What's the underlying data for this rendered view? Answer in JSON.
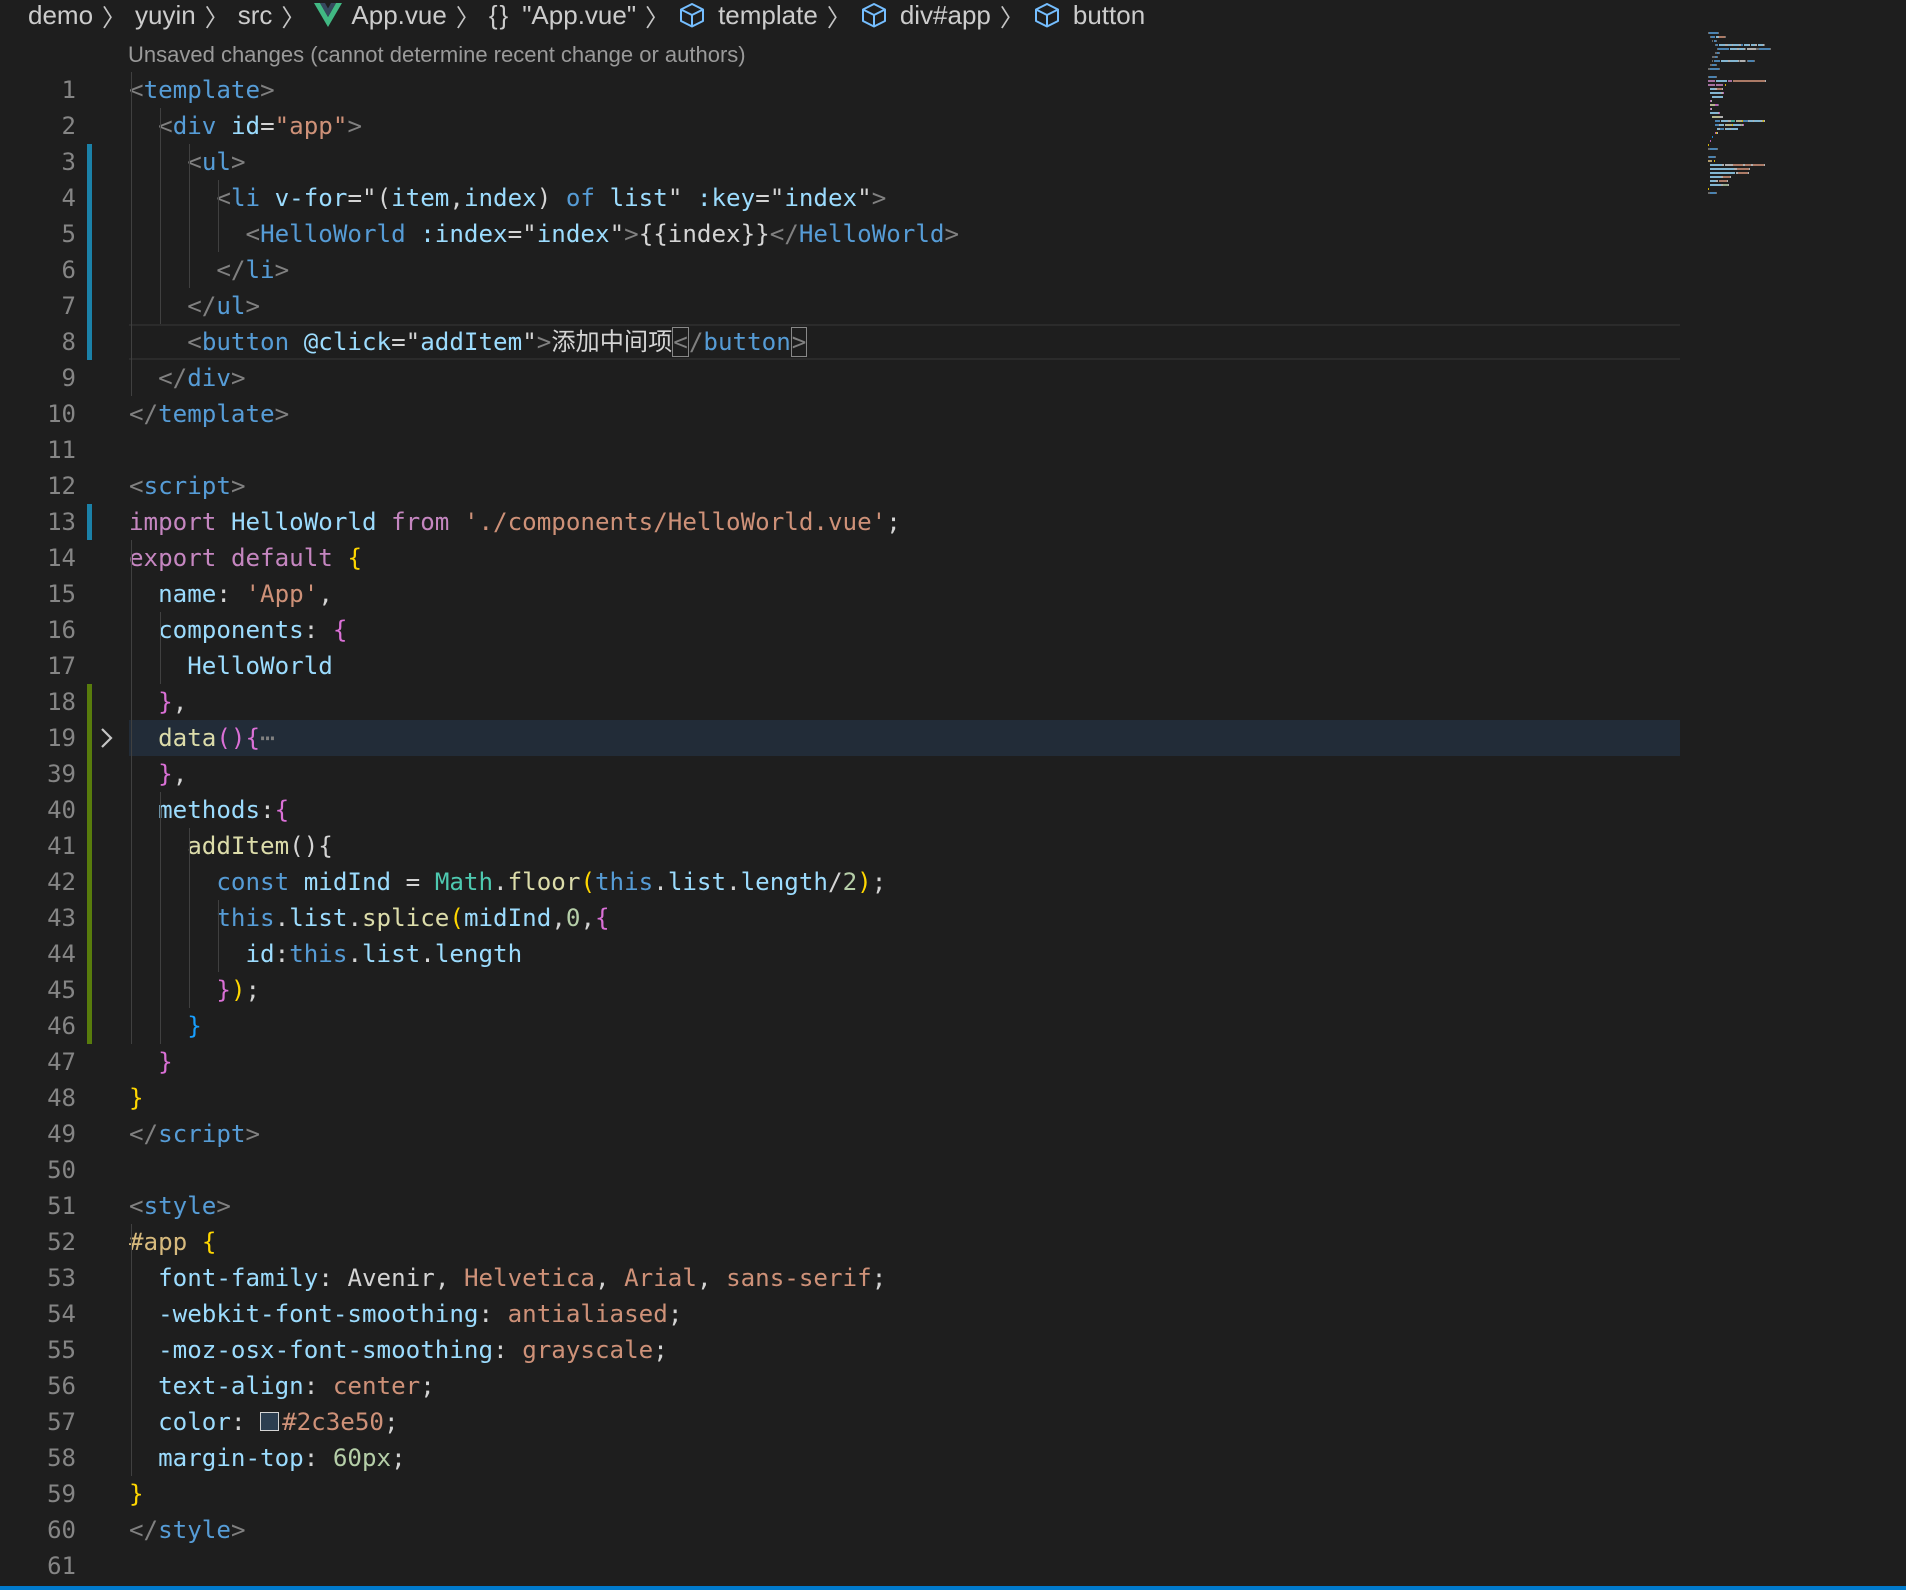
{
  "breadcrumb": {
    "items": [
      "demo",
      "yuyin",
      "src",
      "App.vue",
      "\"App.vue\"",
      "template",
      "div#app",
      "button"
    ],
    "icons": [
      "vue-logo-icon",
      "braces-icon",
      "cube-icon"
    ]
  },
  "codelens": "Unsaved changes (cannot determine recent change or authors)",
  "colors": {
    "background": "#1e1e1e",
    "tag": "#569cd6",
    "attribute": "#9cdcfe",
    "string": "#ce9178",
    "keyword": "#c586c0",
    "gutter_modified": "#1b81a8",
    "gutter_added": "#587c0c",
    "status_bar": "#007acc"
  },
  "editor": {
    "lines": [
      {
        "n": "1",
        "segs": [
          [
            "<",
            "t-punc"
          ],
          [
            "template",
            "t-tag"
          ],
          [
            ">",
            "t-punc"
          ]
        ]
      },
      {
        "n": "2",
        "segs": [
          [
            "  ",
            ""
          ],
          [
            "<",
            "t-punc"
          ],
          [
            "div",
            "t-tag"
          ],
          [
            " ",
            ""
          ],
          [
            "id",
            "t-attr"
          ],
          [
            "=",
            "t-txt"
          ],
          [
            "\"app\"",
            "t-str"
          ],
          [
            ">",
            "t-punc"
          ]
        ]
      },
      {
        "n": "3",
        "segs": [
          [
            "    ",
            ""
          ],
          [
            "<",
            "t-punc"
          ],
          [
            "ul",
            "t-tag"
          ],
          [
            ">",
            "t-punc"
          ]
        ]
      },
      {
        "n": "4",
        "segs": [
          [
            "      ",
            ""
          ],
          [
            "<",
            "t-punc"
          ],
          [
            "li",
            "t-tag"
          ],
          [
            " ",
            ""
          ],
          [
            "v-for",
            "t-attr"
          ],
          [
            "=\"",
            "t-txt"
          ],
          [
            "(",
            "t-txt"
          ],
          [
            "item",
            "t-attr"
          ],
          [
            ",",
            "t-txt"
          ],
          [
            "index",
            "t-attr"
          ],
          [
            ") ",
            "t-txt"
          ],
          [
            "of",
            "t-tag"
          ],
          [
            " ",
            ""
          ],
          [
            "list",
            "t-attr"
          ],
          [
            "\"",
            "t-txt"
          ],
          [
            " ",
            ""
          ],
          [
            ":key",
            "t-attr"
          ],
          [
            "=\"",
            "t-txt"
          ],
          [
            "index",
            "t-attr"
          ],
          [
            "\"",
            "t-txt"
          ],
          [
            ">",
            "t-punc"
          ]
        ]
      },
      {
        "n": "5",
        "segs": [
          [
            "        ",
            ""
          ],
          [
            "<",
            "t-punc"
          ],
          [
            "HelloWorld",
            "t-tag"
          ],
          [
            " ",
            ""
          ],
          [
            ":index",
            "t-attr"
          ],
          [
            "=\"",
            "t-txt"
          ],
          [
            "index",
            "t-attr"
          ],
          [
            "\"",
            "t-txt"
          ],
          [
            ">",
            "t-punc"
          ],
          [
            "{{index}}",
            "t-txt"
          ],
          [
            "</",
            "t-punc"
          ],
          [
            "HelloWorld",
            "t-tag"
          ],
          [
            ">",
            "t-punc"
          ]
        ]
      },
      {
        "n": "6",
        "segs": [
          [
            "      ",
            ""
          ],
          [
            "</",
            "t-punc"
          ],
          [
            "li",
            "t-tag"
          ],
          [
            ">",
            "t-punc"
          ]
        ]
      },
      {
        "n": "7",
        "segs": [
          [
            "    ",
            ""
          ],
          [
            "</",
            "t-punc"
          ],
          [
            "ul",
            "t-tag"
          ],
          [
            ">",
            "t-punc"
          ]
        ]
      },
      {
        "n": "8",
        "segs": [
          [
            "    ",
            ""
          ],
          [
            "<",
            "t-punc"
          ],
          [
            "button",
            "t-tag"
          ],
          [
            " ",
            ""
          ],
          [
            "@click",
            "t-attr"
          ],
          [
            "=\"",
            "t-txt"
          ],
          [
            "addItem",
            "t-attr"
          ],
          [
            "\"",
            "t-txt"
          ],
          [
            ">",
            "t-punc"
          ],
          [
            "添加中间项",
            "t-txt"
          ],
          [
            "<",
            "t-punc bracket-box"
          ],
          [
            "/",
            "t-punc"
          ],
          [
            "button",
            "t-tag"
          ],
          [
            ">",
            "t-punc bracket-box"
          ]
        ]
      },
      {
        "n": "9",
        "segs": [
          [
            "  ",
            ""
          ],
          [
            "</",
            "t-punc"
          ],
          [
            "div",
            "t-tag"
          ],
          [
            ">",
            "t-punc"
          ]
        ]
      },
      {
        "n": "10",
        "segs": [
          [
            "</",
            "t-punc"
          ],
          [
            "template",
            "t-tag"
          ],
          [
            ">",
            "t-punc"
          ]
        ]
      },
      {
        "n": "11",
        "segs": []
      },
      {
        "n": "12",
        "segs": [
          [
            "<",
            "t-punc"
          ],
          [
            "script",
            "t-tag"
          ],
          [
            ">",
            "t-punc"
          ]
        ]
      },
      {
        "n": "13",
        "segs": [
          [
            "import",
            "t-kw"
          ],
          [
            " ",
            ""
          ],
          [
            "HelloWorld",
            "t-attr"
          ],
          [
            " ",
            ""
          ],
          [
            "from",
            "t-kw"
          ],
          [
            " ",
            ""
          ],
          [
            "'./components/HelloWorld.vue'",
            "t-str"
          ],
          [
            ";",
            "t-txt"
          ]
        ]
      },
      {
        "n": "14",
        "segs": [
          [
            "export",
            "t-kw"
          ],
          [
            " ",
            ""
          ],
          [
            "default",
            "t-kw"
          ],
          [
            " ",
            ""
          ],
          [
            "{",
            "b1"
          ]
        ]
      },
      {
        "n": "15",
        "segs": [
          [
            "  ",
            ""
          ],
          [
            "name",
            "t-attr"
          ],
          [
            ": ",
            "t-txt"
          ],
          [
            "'App'",
            "t-str"
          ],
          [
            ",",
            "t-txt"
          ]
        ]
      },
      {
        "n": "16",
        "segs": [
          [
            "  ",
            ""
          ],
          [
            "components",
            "t-attr"
          ],
          [
            ": ",
            "t-txt"
          ],
          [
            "{",
            "b2"
          ]
        ]
      },
      {
        "n": "17",
        "segs": [
          [
            "    ",
            ""
          ],
          [
            "HelloWorld",
            "t-attr"
          ]
        ]
      },
      {
        "n": "18",
        "segs": [
          [
            "  ",
            ""
          ],
          [
            "}",
            "b2"
          ],
          [
            ",",
            "t-txt"
          ]
        ]
      },
      {
        "n": "19",
        "segs": [
          [
            "  ",
            ""
          ],
          [
            "data",
            "t-fn"
          ],
          [
            "()",
            "b2"
          ],
          [
            "{",
            "b2"
          ],
          [
            "⋯",
            "t-ell"
          ]
        ]
      },
      {
        "n": "39",
        "segs": [
          [
            "  ",
            ""
          ],
          [
            "}",
            "b2"
          ],
          [
            ",",
            "t-txt"
          ]
        ]
      },
      {
        "n": "40",
        "segs": [
          [
            "  ",
            ""
          ],
          [
            "methods",
            "t-attr"
          ],
          [
            ":",
            "t-txt"
          ],
          [
            "{",
            "b2"
          ]
        ]
      },
      {
        "n": "41",
        "segs": [
          [
            "    ",
            ""
          ],
          [
            "addItem",
            "t-fn"
          ],
          [
            "(){",
            "t-txt"
          ]
        ]
      },
      {
        "n": "42",
        "segs": [
          [
            "      ",
            ""
          ],
          [
            "const",
            "t-this"
          ],
          [
            " ",
            ""
          ],
          [
            "midInd",
            "t-attr"
          ],
          [
            " = ",
            "t-txt"
          ],
          [
            "Math",
            "t-type"
          ],
          [
            ".",
            "t-txt"
          ],
          [
            "floor",
            "t-fn"
          ],
          [
            "(",
            "b1"
          ],
          [
            "this",
            "t-this"
          ],
          [
            ".",
            "t-txt"
          ],
          [
            "list",
            "t-attr"
          ],
          [
            ".",
            "t-txt"
          ],
          [
            "length",
            "t-attr"
          ],
          [
            "/",
            "t-txt"
          ],
          [
            "2",
            "t-num"
          ],
          [
            ")",
            "b1"
          ],
          [
            ";",
            "t-txt"
          ]
        ]
      },
      {
        "n": "43",
        "segs": [
          [
            "      ",
            ""
          ],
          [
            "this",
            "t-this"
          ],
          [
            ".",
            "t-txt"
          ],
          [
            "list",
            "t-attr"
          ],
          [
            ".",
            "t-txt"
          ],
          [
            "splice",
            "t-fn"
          ],
          [
            "(",
            "b1"
          ],
          [
            "midInd",
            "t-attr"
          ],
          [
            ",",
            "t-txt"
          ],
          [
            "0",
            "t-num"
          ],
          [
            ",",
            "t-txt"
          ],
          [
            "{",
            "b2"
          ]
        ]
      },
      {
        "n": "44",
        "segs": [
          [
            "        ",
            ""
          ],
          [
            "id",
            "t-attr"
          ],
          [
            ":",
            "t-txt"
          ],
          [
            "this",
            "t-this"
          ],
          [
            ".",
            "t-txt"
          ],
          [
            "list",
            "t-attr"
          ],
          [
            ".",
            "t-txt"
          ],
          [
            "length",
            "t-attr"
          ]
        ]
      },
      {
        "n": "45",
        "segs": [
          [
            "      ",
            ""
          ],
          [
            "}",
            "b2"
          ],
          [
            ")",
            "b1"
          ],
          [
            ";",
            "t-txt"
          ]
        ]
      },
      {
        "n": "46",
        "segs": [
          [
            "    ",
            ""
          ],
          [
            "}",
            "b3"
          ]
        ]
      },
      {
        "n": "47",
        "segs": [
          [
            "  ",
            ""
          ],
          [
            "}",
            "b2"
          ]
        ]
      },
      {
        "n": "48",
        "segs": [
          [
            "}",
            "b1"
          ]
        ]
      },
      {
        "n": "49",
        "segs": [
          [
            "</",
            "t-punc"
          ],
          [
            "script",
            "t-tag"
          ],
          [
            ">",
            "t-punc"
          ]
        ]
      },
      {
        "n": "50",
        "segs": []
      },
      {
        "n": "51",
        "segs": [
          [
            "<",
            "t-punc"
          ],
          [
            "style",
            "t-tag"
          ],
          [
            ">",
            "t-punc"
          ]
        ]
      },
      {
        "n": "52",
        "segs": [
          [
            "#app",
            "t-sel"
          ],
          [
            " ",
            ""
          ],
          [
            "{",
            "b1"
          ]
        ]
      },
      {
        "n": "53",
        "segs": [
          [
            "  ",
            ""
          ],
          [
            "font-family",
            "t-attr"
          ],
          [
            ": ",
            "t-txt"
          ],
          [
            "Avenir",
            "t-txt"
          ],
          [
            ", ",
            "t-txt"
          ],
          [
            "Helvetica",
            "t-str"
          ],
          [
            ", ",
            "t-txt"
          ],
          [
            "Arial",
            "t-str"
          ],
          [
            ", ",
            "t-txt"
          ],
          [
            "sans-serif",
            "t-str"
          ],
          [
            ";",
            "t-txt"
          ]
        ]
      },
      {
        "n": "54",
        "segs": [
          [
            "  ",
            ""
          ],
          [
            "-webkit-font-smoothing",
            "t-attr"
          ],
          [
            ": ",
            "t-txt"
          ],
          [
            "antialiased",
            "t-str"
          ],
          [
            ";",
            "t-txt"
          ]
        ]
      },
      {
        "n": "55",
        "segs": [
          [
            "  ",
            ""
          ],
          [
            "-moz-osx-font-smoothing",
            "t-attr"
          ],
          [
            ": ",
            "t-txt"
          ],
          [
            "grayscale",
            "t-str"
          ],
          [
            ";",
            "t-txt"
          ]
        ]
      },
      {
        "n": "56",
        "segs": [
          [
            "  ",
            ""
          ],
          [
            "text-align",
            "t-attr"
          ],
          [
            ": ",
            "t-txt"
          ],
          [
            "center",
            "t-str"
          ],
          [
            ";",
            "t-txt"
          ]
        ]
      },
      {
        "n": "57",
        "segs": [
          [
            "  ",
            ""
          ],
          [
            "color",
            "t-attr"
          ],
          [
            ": ",
            "t-txt"
          ],
          [
            "SWATCH",
            ""
          ],
          [
            "#2c3e50",
            "t-str"
          ],
          [
            ";",
            "t-txt"
          ]
        ]
      },
      {
        "n": "58",
        "segs": [
          [
            "  ",
            ""
          ],
          [
            "margin-top",
            "t-attr"
          ],
          [
            ": ",
            "t-txt"
          ],
          [
            "60px",
            "t-num"
          ],
          [
            ";",
            "t-txt"
          ]
        ]
      },
      {
        "n": "59",
        "segs": [
          [
            "}",
            "b1"
          ]
        ]
      },
      {
        "n": "60",
        "segs": [
          [
            "</",
            "t-punc"
          ],
          [
            "style",
            "t-tag"
          ],
          [
            ">",
            "t-punc"
          ]
        ]
      },
      {
        "n": "61",
        "segs": []
      }
    ]
  }
}
